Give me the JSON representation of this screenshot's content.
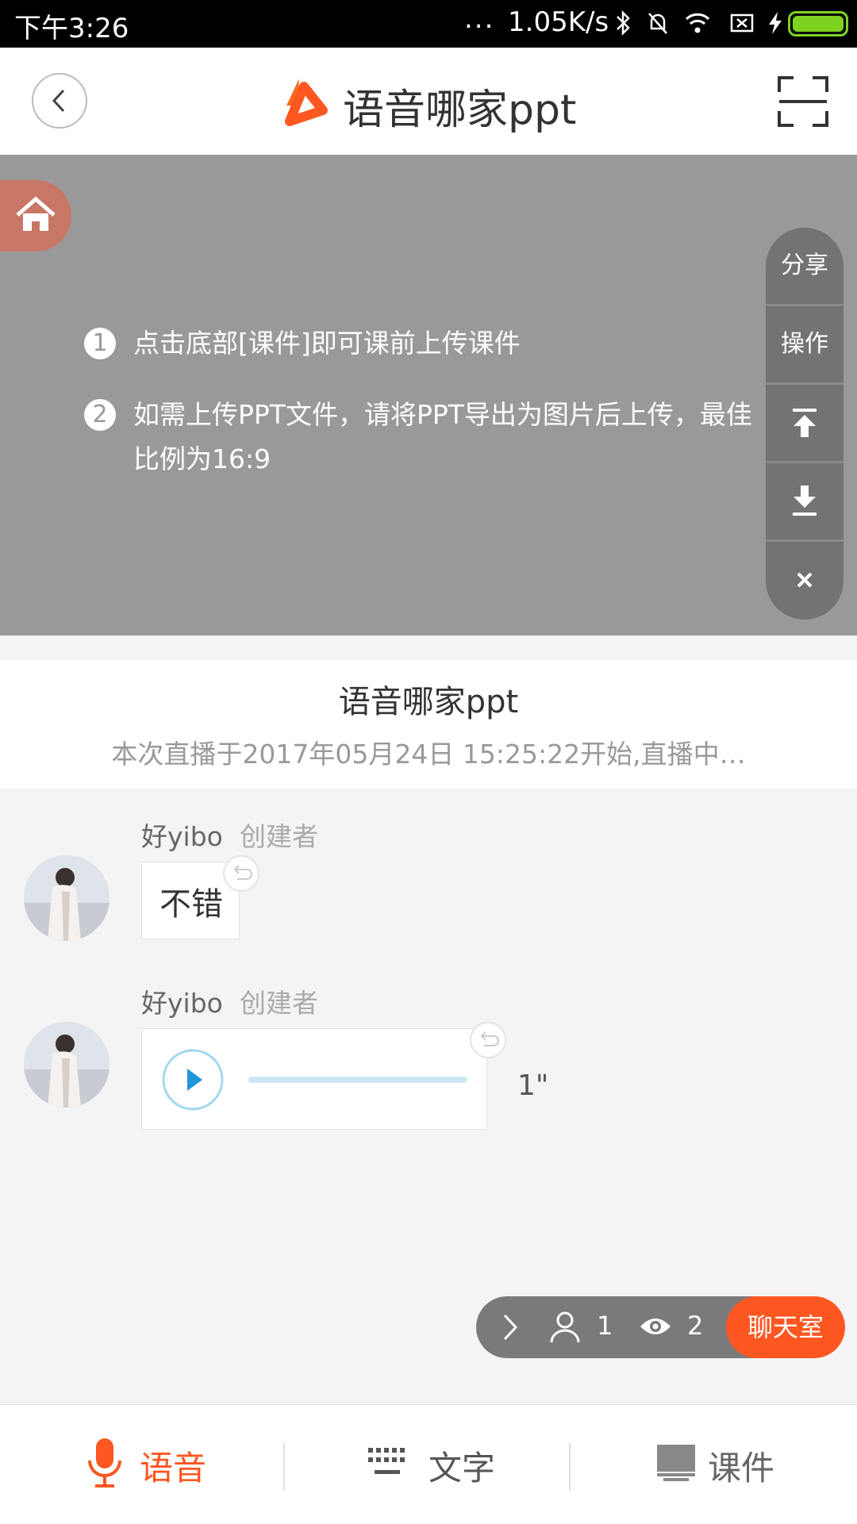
{
  "status_bar": {
    "time": "下午3:26",
    "dots": "...",
    "speed": "1.05K/s"
  },
  "header": {
    "title": "语音哪家ppt"
  },
  "slide": {
    "hints": [
      {
        "num": "1",
        "text": "点击底部[课件]即可课前上传课件"
      },
      {
        "num": "2",
        "text": "如需上传PPT文件，请将PPT导出为图片后上传，最佳比例为16:9"
      }
    ],
    "side_controls": {
      "share": "分享",
      "operate": "操作"
    }
  },
  "live_info": {
    "title": "语音哪家ppt",
    "subtitle": "本次直播于2017年05月24日 15:25:22开始,直播中…"
  },
  "messages": [
    {
      "user": "好yibo",
      "role": "创建者",
      "text": "不错"
    },
    {
      "user": "好yibo",
      "role": "创建者",
      "duration": "1\""
    }
  ],
  "stats": {
    "people": "1",
    "views": "2",
    "chat_room": "聊天室"
  },
  "bottom_tabs": {
    "voice": "语音",
    "text": "文字",
    "courseware": "课件"
  },
  "colors": {
    "accent": "#ff5722",
    "slide_bg": "#999999"
  }
}
